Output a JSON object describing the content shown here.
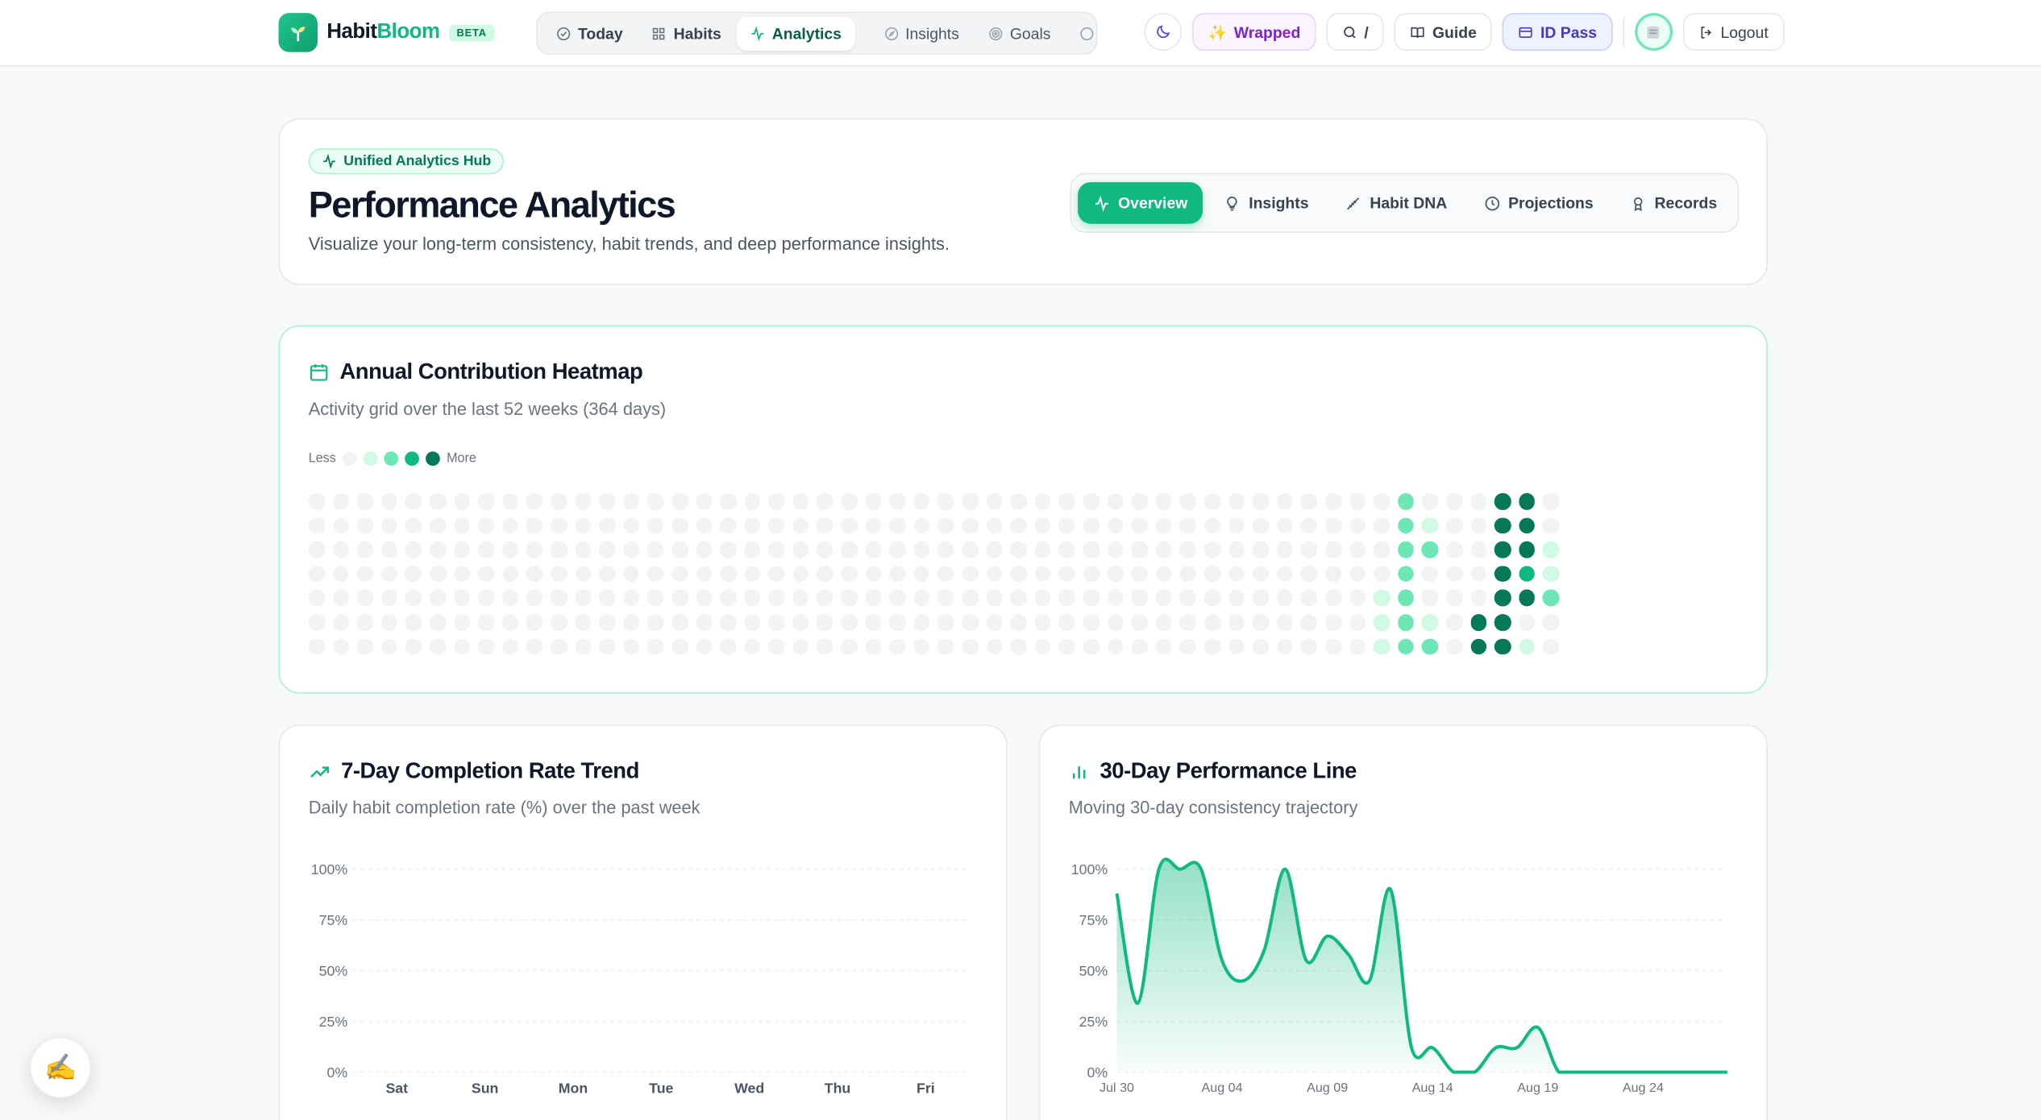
{
  "brand": {
    "name_part1": "Habit",
    "name_part2": "Bloom",
    "badge": "BETA"
  },
  "nav": {
    "items": [
      {
        "label": "Today",
        "icon": "check-circle-icon"
      },
      {
        "label": "Habits",
        "icon": "grid-icon"
      },
      {
        "label": "Analytics",
        "icon": "activity-icon",
        "active": true
      },
      {
        "label": "Insights",
        "icon": "compass-icon"
      },
      {
        "label": "Goals",
        "icon": "target-icon"
      }
    ],
    "search_shortcut": "/",
    "wrapped": "Wrapped",
    "guide": "Guide",
    "id_pass": "ID Pass",
    "logout": "Logout"
  },
  "hero": {
    "badge": "Unified Analytics Hub",
    "title": "Performance Analytics",
    "subtitle": "Visualize your long-term consistency, habit trends, and deep performance insights.",
    "tabs": [
      {
        "label": "Overview",
        "icon": "activity-icon",
        "active": true
      },
      {
        "label": "Insights",
        "icon": "lightbulb-icon"
      },
      {
        "label": "Habit DNA",
        "icon": "dna-icon"
      },
      {
        "label": "Projections",
        "icon": "clock-icon"
      },
      {
        "label": "Records",
        "icon": "award-icon"
      }
    ]
  },
  "heatmap": {
    "title": "Annual Contribution Heatmap",
    "subtitle": "Activity grid over the last 52 weeks (364 days)",
    "legend_less": "Less",
    "legend_more": "More",
    "colors": [
      "#f1f3f5",
      "#d1fae5",
      "#6ee7b7",
      "#10b981",
      "#047857"
    ],
    "active_weeks": {
      "44": [
        0,
        0,
        0,
        0,
        1,
        1,
        1
      ],
      "45": [
        2,
        2,
        2,
        2,
        2,
        2,
        2
      ],
      "46": [
        0,
        1,
        2,
        0,
        0,
        1,
        2
      ],
      "47": [
        0,
        0,
        0,
        0,
        0,
        0,
        0
      ],
      "48": [
        0,
        0,
        0,
        0,
        0,
        4,
        4
      ],
      "49": [
        4,
        4,
        4,
        4,
        4,
        4,
        4
      ],
      "50": [
        4,
        4,
        4,
        3,
        4,
        0,
        1
      ],
      "51": [
        0,
        0,
        1,
        1,
        2,
        0,
        0
      ]
    }
  },
  "chart_weekly": {
    "title": "7-Day Completion Rate Trend",
    "subtitle": "Daily habit completion rate (%) over the past week",
    "chart_data": {
      "type": "bar",
      "categories": [
        "Sat",
        "Sun",
        "Mon",
        "Tue",
        "Wed",
        "Thu",
        "Fri"
      ],
      "values": [
        0,
        0,
        0,
        0,
        0,
        0,
        0
      ],
      "yticks": [
        "0%",
        "25%",
        "50%",
        "75%",
        "100%"
      ],
      "ylim": [
        0,
        100
      ]
    }
  },
  "chart_monthly": {
    "title": "30-Day Performance Line",
    "subtitle": "Moving 30-day consistency trajectory",
    "chart_data": {
      "type": "area",
      "x": [
        "Jul 30",
        "Jul 31",
        "Aug 01",
        "Aug 02",
        "Aug 03",
        "Aug 04",
        "Aug 05",
        "Aug 06",
        "Aug 07",
        "Aug 08",
        "Aug 09",
        "Aug 10",
        "Aug 11",
        "Aug 12",
        "Aug 13",
        "Aug 14",
        "Aug 15",
        "Aug 16",
        "Aug 17",
        "Aug 18",
        "Aug 19",
        "Aug 20",
        "Aug 21",
        "Aug 22",
        "Aug 23",
        "Aug 24",
        "Aug 25",
        "Aug 26",
        "Aug 27",
        "Aug 28"
      ],
      "values": [
        88,
        34,
        100,
        100,
        100,
        55,
        45,
        60,
        100,
        55,
        67,
        58,
        45,
        90,
        12,
        12,
        0,
        0,
        12,
        12,
        22,
        0,
        0,
        0,
        0,
        0,
        0,
        0,
        0,
        0
      ],
      "xticks": [
        "Jul 30",
        "Aug 04",
        "Aug 09",
        "Aug 14",
        "Aug 19",
        "Aug 24"
      ],
      "yticks": [
        "0%",
        "25%",
        "50%",
        "75%",
        "100%"
      ],
      "ylim": [
        0,
        100
      ],
      "color": "#10b981"
    }
  }
}
